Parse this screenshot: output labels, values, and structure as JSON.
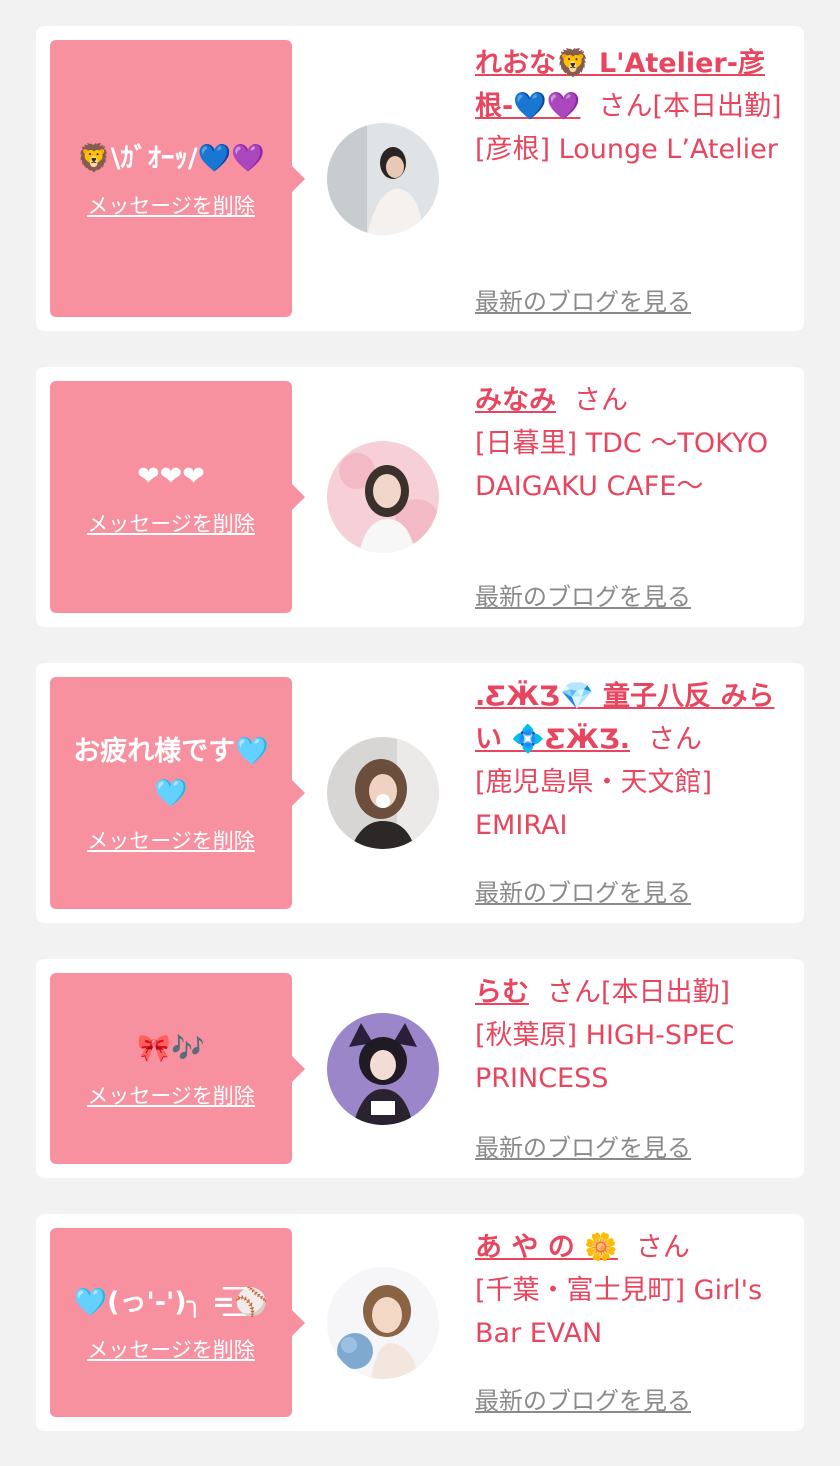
{
  "entries": [
    {
      "message": "🦁\\ｶﾞｵｰｯ/💙💜",
      "delete_label": "メッセージを削除",
      "name": "れおな🦁 L'Atelier-彦根-💙💜",
      "honorific": "さん",
      "status": "[本日出勤]",
      "shop": "[彦根] Lounge L’Atelier",
      "blog_label": "最新のブログを見る"
    },
    {
      "message": "❤❤❤",
      "delete_label": "メッセージを削除",
      "name": "みなみ",
      "honorific": "さん",
      "status": "",
      "shop": "[日暮里] TDC 〜TOKYO DAIGAKU CAFE〜",
      "blog_label": "最新のブログを見る"
    },
    {
      "message": "お疲れ様です🩵🩵",
      "delete_label": "メッセージを削除",
      "name": ".ƸӜƷ💎 童子八反 みらい 💠ƸӜƷ.",
      "honorific": "さん",
      "status": "",
      "shop": "[鹿児島県・天文館] EMIRAI",
      "blog_label": "最新のブログを見る"
    },
    {
      "message": "🎀🎶",
      "delete_label": "メッセージを削除",
      "name": "らむ",
      "honorific": "さん",
      "status": "[本日出勤]",
      "shop": "[秋葉原] HIGH-SPEC PRINCESS",
      "blog_label": "最新のブログを見る"
    },
    {
      "message": "🩵(っ'-')╮ =͟͟͞͞⚾",
      "delete_label": "メッセージを削除",
      "name": "あ や の 🌼",
      "honorific": "さん",
      "status": "",
      "shop": "[千葉・富士見町] Girl's Bar EVAN",
      "blog_label": "最新のブログを見る"
    }
  ]
}
